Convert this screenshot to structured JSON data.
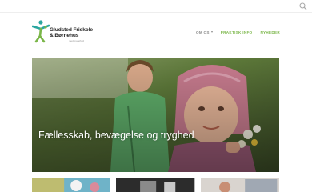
{
  "topbar": {
    "search_icon": "search-icon"
  },
  "logo": {
    "line1": "Gludsted Friskole",
    "line2": "& Børnehus",
    "tagline": "med mangfold",
    "brand_colors": {
      "green": "#7ab648",
      "teal": "#2aa6a0"
    }
  },
  "nav": {
    "items": [
      {
        "label": "OM OS",
        "has_dropdown": true
      },
      {
        "label": "PRAKTISK INFO",
        "has_dropdown": false
      },
      {
        "label": "NYHEDER",
        "has_dropdown": false
      }
    ],
    "accent_color": "#7ab648"
  },
  "hero": {
    "title": "Fællesskab, bevægelse og tryghed"
  },
  "thumbnails": {
    "count": 3
  }
}
